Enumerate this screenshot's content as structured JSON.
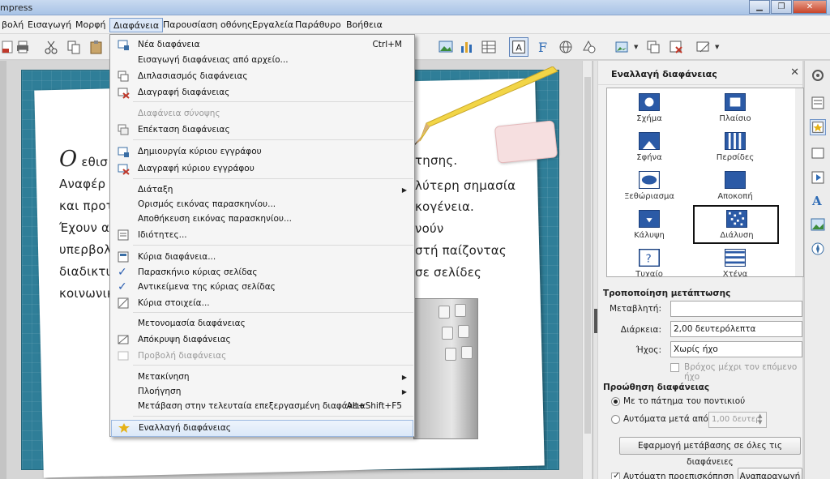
{
  "window": {
    "title": "mpress"
  },
  "menubar": [
    "βολή",
    "Εισαγωγή",
    "Μορφή",
    "Διαφάνεια",
    "Παρουσίαση οθόνης",
    "Εργαλεία",
    "Παράθυρο",
    "Βοήθεια"
  ],
  "slide": {
    "first_letter": "Ο",
    "lines": [
      "εθισ",
      "Αναφέρ",
      "και προτ",
      "Έχουν α",
      "υπερβολ",
      "διαδικτυ",
      "κοινωνικ"
    ],
    "right_lines": [
      "τησης.",
      "λύτερη σημασία",
      "κογένεια.",
      "νούν",
      "στή παίζοντας",
      "σε σελίδες"
    ]
  },
  "menu": {
    "items": [
      {
        "label": "Νέα διαφάνεια",
        "shortcut": "Ctrl+M",
        "icon": "new-slide-icon"
      },
      {
        "label": "Εισαγωγή διαφάνειας από αρχείο...",
        "shortcut": "",
        "icon": ""
      },
      {
        "label": "Διπλασιασμός διαφάνειας",
        "shortcut": "",
        "icon": "duplicate-slide-icon"
      },
      {
        "label": "Διαγραφή διαφάνειας",
        "shortcut": "",
        "icon": "delete-slide-icon"
      },
      {
        "label": "Διαφάνεια σύνοψης",
        "shortcut": "",
        "icon": "",
        "disabled": true
      },
      {
        "label": "Επέκταση διαφάνειας",
        "shortcut": "",
        "icon": "expand-slide-icon"
      },
      {
        "label": "Δημιουργία κύριου εγγράφου",
        "shortcut": "",
        "icon": "new-master-icon"
      },
      {
        "label": "Διαγραφή κύριου εγγράφου",
        "shortcut": "",
        "icon": "delete-master-icon"
      },
      {
        "label": "Διάταξη",
        "submenu": true
      },
      {
        "label": "Ορισμός εικόνας παρασκηνίου...",
        "shortcut": ""
      },
      {
        "label": "Αποθήκευση εικόνας παρασκηνίου...",
        "shortcut": ""
      },
      {
        "label": "Ιδιότητες...",
        "shortcut": "",
        "icon": "properties-icon"
      },
      {
        "label": "Κύρια διαφάνεια...",
        "shortcut": "",
        "icon": "master-slide-icon"
      },
      {
        "label": "Παρασκήνιο κύριας σελίδας",
        "checked": true
      },
      {
        "label": "Αντικείμενα της κύριας σελίδας",
        "checked": true
      },
      {
        "label": "Κύρια στοιχεία...",
        "icon": "master-elements-icon"
      },
      {
        "label": "Μετονομασία διαφάνειας"
      },
      {
        "label": "Απόκρυψη διαφάνειας",
        "icon": "hide-slide-icon"
      },
      {
        "label": "Προβολή διαφάνειας",
        "icon": "show-slide-icon",
        "disabled": true
      },
      {
        "label": "Μετακίνηση",
        "submenu": true
      },
      {
        "label": "Πλοήγηση",
        "submenu": true
      },
      {
        "label": "Μετάβαση στην τελευταία επεξεργασμένη διαφάνεια",
        "shortcut": "Alt+Shift+F5"
      },
      {
        "label": "Εναλλαγή διαφάνειας",
        "icon": "slide-transition-icon",
        "highlighted": true
      }
    ]
  },
  "panel": {
    "title": "Εναλλαγή διαφάνειας",
    "transitions": [
      "Σχήμα",
      "Πλαίσιο",
      "Σφήνα",
      "Περσίδες",
      "Ξεθώριασμα",
      "Αποκοπή",
      "Κάλυψη",
      "Διάλυση",
      "Τυχαίο",
      "Χτένα"
    ],
    "selected_transition": "Διάλυση",
    "modify_heading": "Τροποποίηση μετάπτωσης",
    "variant_label": "Μεταβλητή:",
    "variant_value": "",
    "duration_label": "Διάρκεια:",
    "duration_value": "2,00 δευτερόλεπτα",
    "sound_label": "Ήχος:",
    "sound_value": "Χωρίς ήχο",
    "loop_label": "Βρόχος μέχρι τον επόμενο ήχο",
    "advance_heading": "Προώθηση διαφάνειας",
    "on_click_label": "Με το πάτημα του ποντικιού",
    "auto_label": "Αυτόματα μετά από:",
    "auto_value": "1,00 δευτερ",
    "apply_all_button": "Εφαρμογή μετάβασης σε όλες τις διαφάνειες",
    "auto_preview_label": "Αυτόματη προεπισκόπηση",
    "play_button": "Αναπαραγωγή"
  }
}
